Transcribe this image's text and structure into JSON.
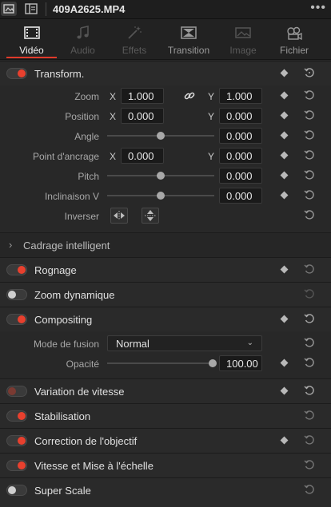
{
  "clip": {
    "title": "409A2625.MP4",
    "more_label": "•••"
  },
  "tabs": [
    {
      "label": "Vidéo",
      "icon": "film-icon",
      "state": "active"
    },
    {
      "label": "Audio",
      "icon": "music-note-icon",
      "state": "disabled"
    },
    {
      "label": "Effets",
      "icon": "magic-wand-icon",
      "state": "disabled"
    },
    {
      "label": "Transition",
      "icon": "transition-icon",
      "state": "normal"
    },
    {
      "label": "Image",
      "icon": "image-icon",
      "state": "disabled"
    },
    {
      "label": "Fichier",
      "icon": "film-reel-icon",
      "state": "normal"
    }
  ],
  "transform": {
    "title": "Transform.",
    "enabled": true,
    "zoom": {
      "label": "Zoom",
      "x_axis": "X",
      "x": "1.000",
      "y_axis": "Y",
      "y": "1.000",
      "linked": true
    },
    "position": {
      "label": "Position",
      "x_axis": "X",
      "x": "0.000",
      "y_axis": "Y",
      "y": "0.000"
    },
    "angle": {
      "label": "Angle",
      "value": "0.000",
      "slider_fraction": 0.5
    },
    "anchor": {
      "label": "Point d'ancrage",
      "x_axis": "X",
      "x": "0.000",
      "y_axis": "Y",
      "y": "0.000"
    },
    "pitch": {
      "label": "Pitch",
      "value": "0.000",
      "slider_fraction": 0.5
    },
    "yaw": {
      "label": "Inclinaison V",
      "value": "0.000",
      "slider_fraction": 0.5
    },
    "flip": {
      "label": "Inverser"
    }
  },
  "smart_reframe": {
    "title": "Cadrage intelligent"
  },
  "crop": {
    "title": "Rognage",
    "enabled": true
  },
  "dynamic_zoom": {
    "title": "Zoom dynamique",
    "enabled": false
  },
  "compositing": {
    "title": "Compositing",
    "enabled": true,
    "blend_mode": {
      "label": "Mode de fusion",
      "value": "Normal"
    },
    "opacity": {
      "label": "Opacité",
      "value": "100.00",
      "slider_fraction": 1.0
    }
  },
  "speed_change": {
    "title": "Variation de vitesse",
    "enabled": true
  },
  "stabilization": {
    "title": "Stabilisation",
    "enabled": true
  },
  "lens_correction": {
    "title": "Correction de l'objectif",
    "enabled": true
  },
  "retime_scaling": {
    "title": "Vitesse et Mise à l'échelle",
    "enabled": true
  },
  "super_scale": {
    "title": "Super Scale",
    "enabled": false
  },
  "colors": {
    "accent": "#e8402e",
    "panel": "#282828",
    "field": "#1a1a1a"
  }
}
